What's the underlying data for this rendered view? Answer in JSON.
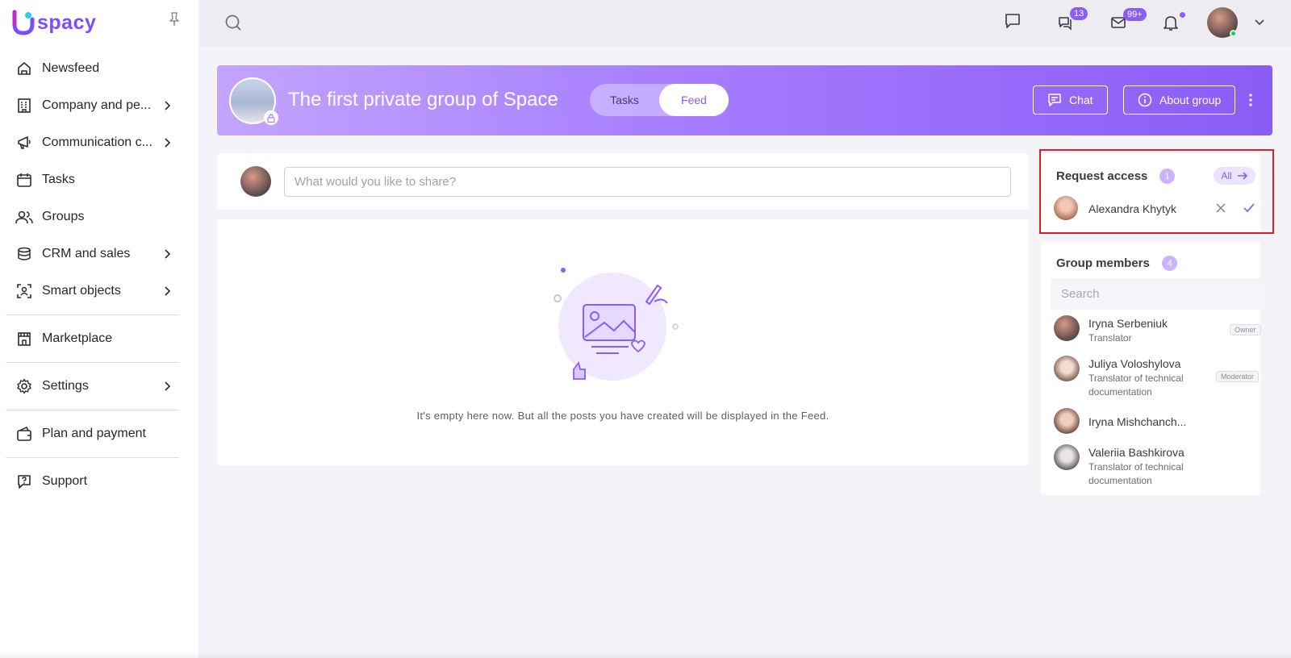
{
  "app": {
    "logo_text": "spacy",
    "brand_color": "#8b5cf6"
  },
  "sidebar": {
    "items": [
      {
        "label": "Newsfeed",
        "icon": "home-icon",
        "has_submenu": false
      },
      {
        "label": "Company and pe...",
        "icon": "building-icon",
        "has_submenu": true
      },
      {
        "label": "Communication c...",
        "icon": "megaphone-icon",
        "has_submenu": true
      },
      {
        "label": "Tasks",
        "icon": "calendar-check-icon",
        "has_submenu": false
      },
      {
        "label": "Groups",
        "icon": "users-icon",
        "has_submenu": false
      },
      {
        "label": "CRM and sales",
        "icon": "coins-icon",
        "has_submenu": true
      },
      {
        "label": "Smart objects",
        "icon": "scan-user-icon",
        "has_submenu": true
      },
      {
        "label": "Marketplace",
        "icon": "store-icon",
        "has_submenu": false
      },
      {
        "label": "Settings",
        "icon": "gear-icon",
        "has_submenu": true
      },
      {
        "label": "Plan and payment",
        "icon": "wallet-icon",
        "has_submenu": false
      },
      {
        "label": "Support",
        "icon": "help-chat-icon",
        "has_submenu": false
      }
    ]
  },
  "topbar": {
    "chats_badge": "13",
    "mail_badge": "99+"
  },
  "group": {
    "title": "The first private group of Space",
    "tabs": [
      "Tasks",
      "Feed"
    ],
    "active_tab": "Feed",
    "chat_button": "Chat",
    "about_button": "About group"
  },
  "composer": {
    "placeholder": "What would you like to share?"
  },
  "feed": {
    "empty_text": "It's empty here now. But all the posts you have created will be displayed in the Feed."
  },
  "request_access": {
    "title": "Request access",
    "count": "1",
    "all_label": "All",
    "requests": [
      {
        "name": "Alexandra Khytyk"
      }
    ]
  },
  "members": {
    "title": "Group members",
    "count": "4",
    "search_placeholder": "Search",
    "list": [
      {
        "name": "Iryna Serbeniuk",
        "role": "Translator",
        "tag": "Owner"
      },
      {
        "name": "Juliya Voloshylova",
        "role": "Translator of technical documentation",
        "tag": "Moderator"
      },
      {
        "name": "Iryna Mishchanch...",
        "role": "",
        "tag": ""
      },
      {
        "name": "Valeriia Bashkirova",
        "role": "Translator of technical documentation",
        "tag": ""
      }
    ]
  }
}
